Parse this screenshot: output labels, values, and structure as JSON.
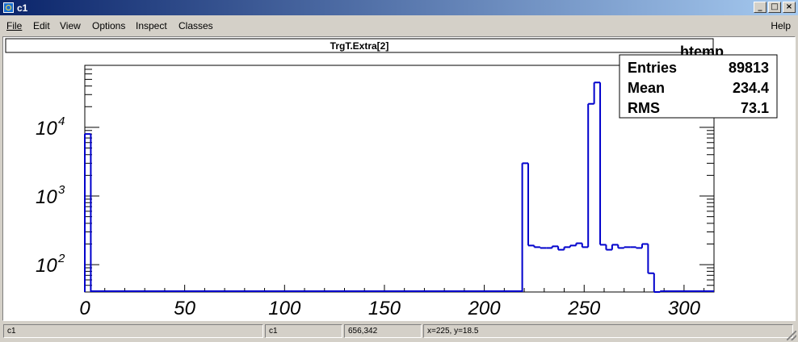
{
  "window": {
    "title": "c1"
  },
  "menu": {
    "file": "File",
    "edit": "Edit",
    "view": "View",
    "options": "Options",
    "inspect": "Inspect",
    "classes": "Classes",
    "help": "Help"
  },
  "status": {
    "cell1": "c1",
    "cell2": "c1",
    "cell3": "656,342",
    "cell4": "x=225, y=18.5"
  },
  "stats": {
    "name": "htemp",
    "rows": [
      {
        "label": "Entries",
        "value": "89813"
      },
      {
        "label": "Mean",
        "value": "234.4"
      },
      {
        "label": "RMS",
        "value": "73.1"
      }
    ]
  },
  "colors": {
    "line": "#0000cc",
    "titlebar": "#0a246a",
    "background": "#d4d0c8"
  },
  "chart_data": {
    "type": "histogram",
    "title": "TrgT.Extra[2]",
    "xlabel": "",
    "ylabel": "",
    "xlim": [
      0,
      315
    ],
    "ylim": [
      40,
      80000
    ],
    "log_y": true,
    "grid": false,
    "legend": "top-right",
    "bin_width": 3,
    "x_ticks": [
      0,
      50,
      100,
      150,
      200,
      250,
      300
    ],
    "x_tick_labels": [
      "0",
      "50",
      "100",
      "150",
      "200",
      "250",
      "300"
    ],
    "y_ticks": [
      100,
      1000,
      10000
    ],
    "y_tick_labels": [
      "10",
      "10",
      "10"
    ],
    "y_tick_exponents": [
      "2",
      "3",
      "4"
    ],
    "bins": [
      {
        "x0": 0,
        "y": 8000
      },
      {
        "x0": 219,
        "y": 3000
      },
      {
        "x0": 222,
        "y": 190
      },
      {
        "x0": 225,
        "y": 180
      },
      {
        "x0": 228,
        "y": 175
      },
      {
        "x0": 231,
        "y": 175
      },
      {
        "x0": 234,
        "y": 185
      },
      {
        "x0": 237,
        "y": 165
      },
      {
        "x0": 240,
        "y": 180
      },
      {
        "x0": 243,
        "y": 190
      },
      {
        "x0": 246,
        "y": 205
      },
      {
        "x0": 249,
        "y": 180
      },
      {
        "x0": 252,
        "y": 22000
      },
      {
        "x0": 255,
        "y": 45000
      },
      {
        "x0": 258,
        "y": 195
      },
      {
        "x0": 261,
        "y": 165
      },
      {
        "x0": 264,
        "y": 195
      },
      {
        "x0": 267,
        "y": 175
      },
      {
        "x0": 270,
        "y": 180
      },
      {
        "x0": 273,
        "y": 180
      },
      {
        "x0": 276,
        "y": 175
      },
      {
        "x0": 279,
        "y": 200
      },
      {
        "x0": 282,
        "y": 75
      },
      {
        "x0": 285,
        "y": 30
      }
    ]
  }
}
